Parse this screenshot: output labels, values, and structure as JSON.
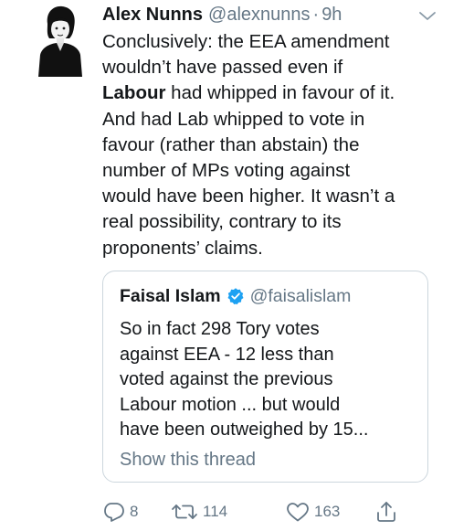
{
  "tweet": {
    "author_name": "Alex Nunns",
    "author_handle": "@alexnunns",
    "separator": "·",
    "time": "9h",
    "text_lines": [
      {
        "pre": "Conclusively: the EEA amendment",
        "bold": "",
        "post": ""
      },
      {
        "pre": "wouldn’t have passed even if",
        "bold": "",
        "post": ""
      },
      {
        "pre": "",
        "bold": "Labour",
        "post": " had whipped in favour of it."
      },
      {
        "pre": "And had Lab whipped to vote in",
        "bold": "",
        "post": ""
      },
      {
        "pre": "favour (rather than abstain) the",
        "bold": "",
        "post": ""
      },
      {
        "pre": "number of MPs voting against",
        "bold": "",
        "post": ""
      },
      {
        "pre": "would have been higher. It wasn’t a",
        "bold": "",
        "post": ""
      },
      {
        "pre": "real possibility, contrary to its",
        "bold": "",
        "post": ""
      },
      {
        "pre": "proponents’ claims.",
        "bold": "",
        "post": ""
      }
    ]
  },
  "quoted_tweet": {
    "author_name": "Faisal Islam",
    "author_handle": "@faisalislam",
    "verified": true,
    "text_lines": [
      "So in fact 298 Tory votes",
      "against EEA - 12 less than",
      "voted against the previous",
      "Labour motion ... but would",
      "have been outweighed by 15..."
    ],
    "show_thread_label": "Show this thread"
  },
  "actions": {
    "reply_count": "8",
    "retweet_count": "114",
    "like_count": "163"
  },
  "colors": {
    "text": "#14171a",
    "secondary": "#657786",
    "border": "#ccd6dd",
    "verified": "#1da1f2"
  },
  "icons": {
    "caret": "chevron-down-icon",
    "verified": "verified-badge-icon",
    "reply": "reply-icon",
    "retweet": "retweet-icon",
    "like": "heart-icon",
    "share": "share-icon"
  }
}
